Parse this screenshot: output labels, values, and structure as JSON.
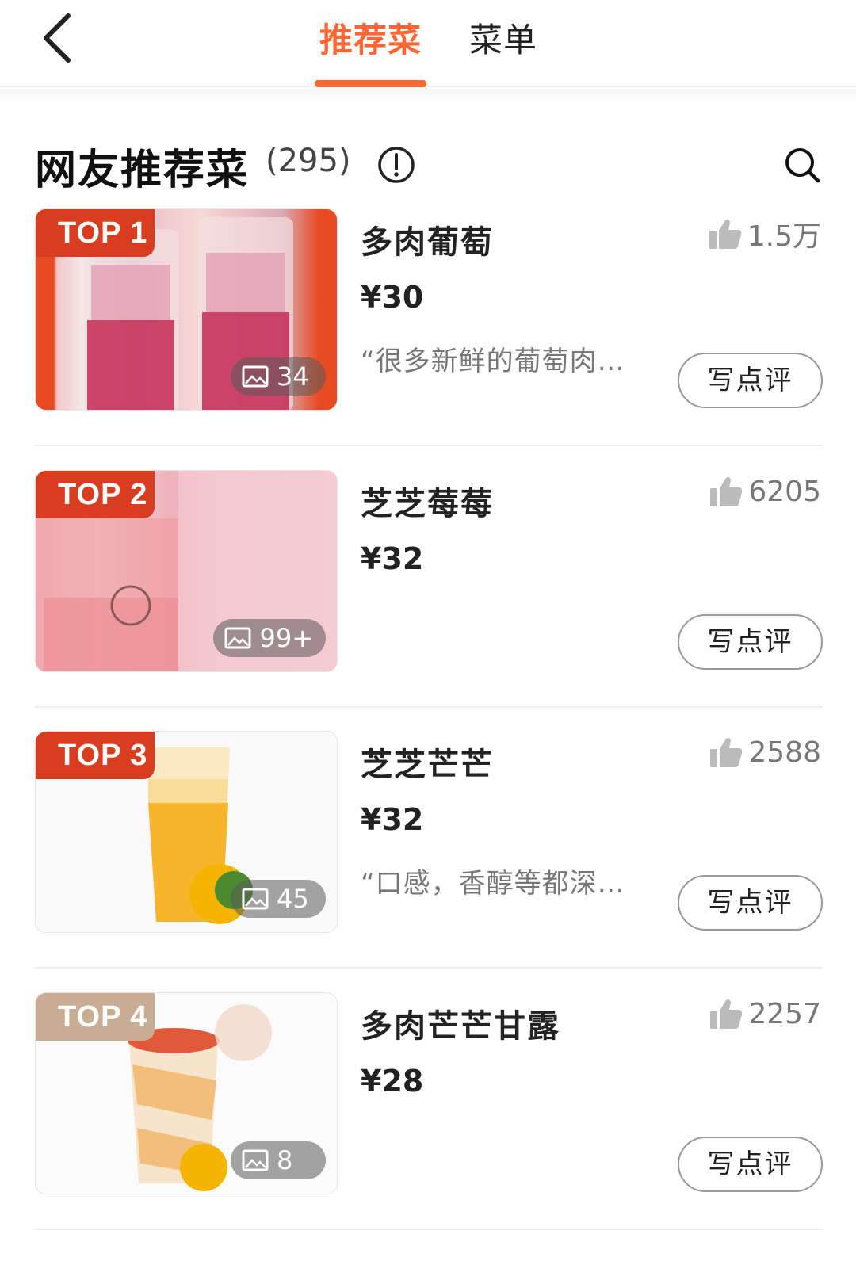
{
  "nav": {
    "tabs": [
      {
        "label": "推荐菜",
        "active": true
      },
      {
        "label": "菜单",
        "active": false
      }
    ]
  },
  "section": {
    "title": "网友推荐菜",
    "count": "(295)"
  },
  "colors": {
    "accent": "#ff6633",
    "badge_top": "#d93d1f",
    "badge_other": "#c9ad92"
  },
  "dishes": [
    {
      "rank": "TOP 1",
      "name": "多肉葡萄",
      "price": "¥30",
      "likes": "1.5万",
      "photos": "34",
      "quote": "“很多新鲜的葡萄肉…",
      "review_label": "写点评"
    },
    {
      "rank": "TOP 2",
      "name": "芝芝莓莓",
      "price": "¥32",
      "likes": "6205",
      "photos": "99+",
      "quote": "",
      "review_label": "写点评"
    },
    {
      "rank": "TOP 3",
      "name": "芝芝芒芒",
      "price": "¥32",
      "likes": "2588",
      "photos": "45",
      "quote": "“口感，香醇等都深…",
      "review_label": "写点评"
    },
    {
      "rank": "TOP 4",
      "name": "多肉芒芒甘露",
      "price": "¥28",
      "likes": "2257",
      "photos": "8",
      "quote": "",
      "review_label": "写点评"
    }
  ]
}
